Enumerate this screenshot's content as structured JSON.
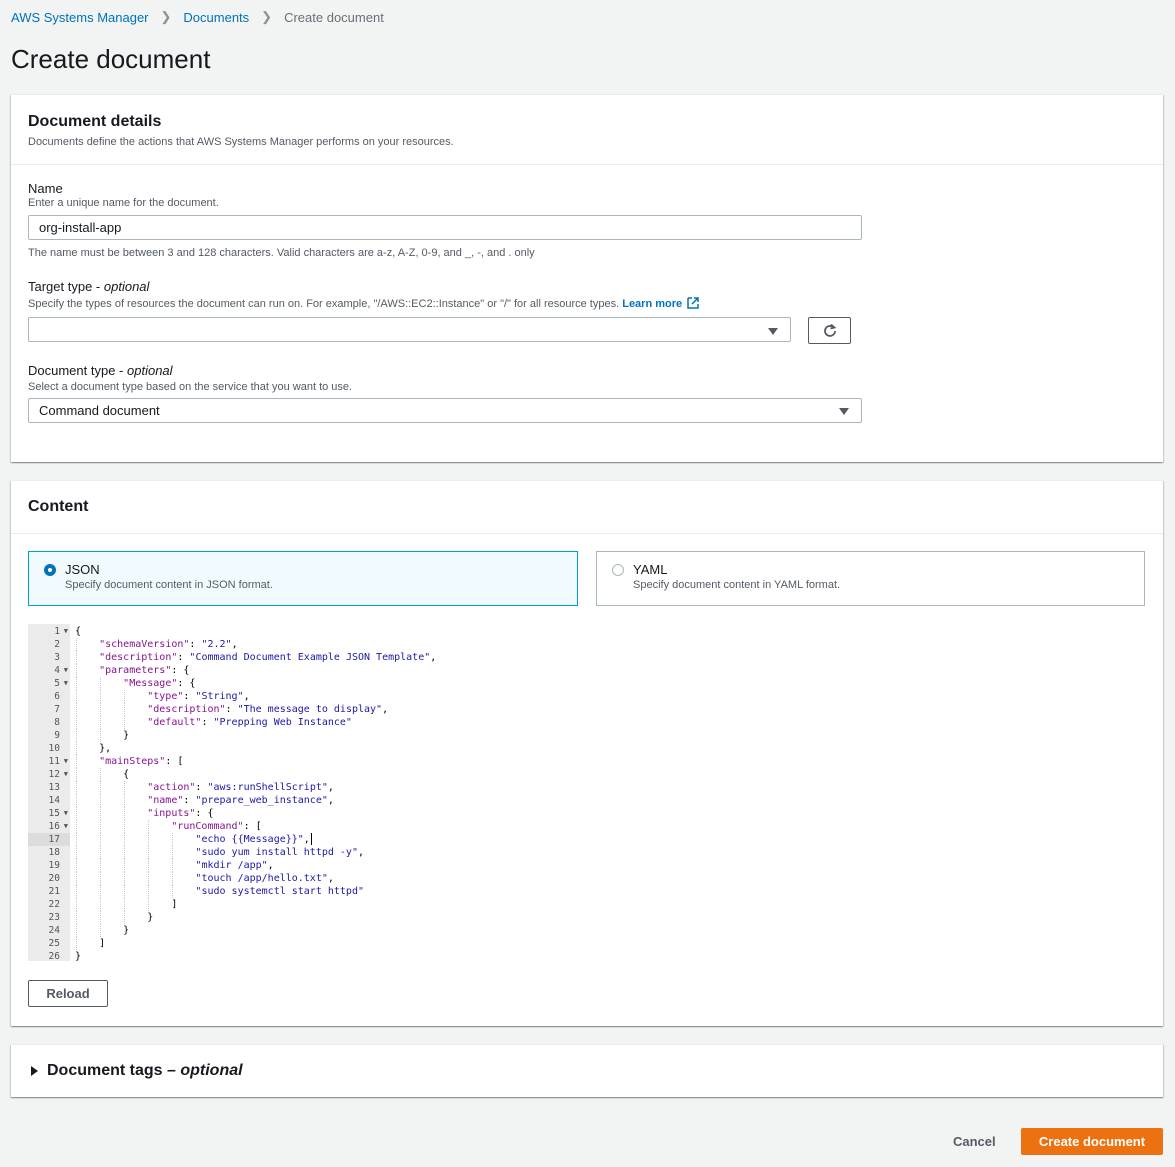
{
  "breadcrumb": {
    "items": [
      "AWS Systems Manager",
      "Documents"
    ],
    "current": "Create document"
  },
  "page_title": "Create document",
  "details": {
    "title": "Document details",
    "description": "Documents define the actions that AWS Systems Manager performs on your resources.",
    "name": {
      "label": "Name",
      "hint": "Enter a unique name for the document.",
      "value": "org-install-app",
      "constraint": "The name must be between 3 and 128 characters. Valid characters are a-z, A-Z, 0-9, and _, -, and . only"
    },
    "target_type": {
      "label": "Target type - ",
      "label_optional": "optional",
      "hint": "Specify the types of resources the document can run on. For example, \"/AWS::EC2::Instance\" or \"/\" for all resource types.",
      "learn_more": "Learn more",
      "value": ""
    },
    "document_type": {
      "label": "Document type - ",
      "label_optional": "optional",
      "hint": "Select a document type based on the service that you want to use.",
      "value": "Command document"
    }
  },
  "content": {
    "title": "Content",
    "formats": [
      {
        "title": "JSON",
        "desc": "Specify document content in JSON format.",
        "selected": true
      },
      {
        "title": "YAML",
        "desc": "Specify document content in YAML format.",
        "selected": false
      }
    ],
    "code_lines": [
      "{",
      "    \"schemaVersion\": \"2.2\",",
      "    \"description\": \"Command Document Example JSON Template\",",
      "    \"parameters\": {",
      "        \"Message\": {",
      "            \"type\": \"String\",",
      "            \"description\": \"The message to display\",",
      "            \"default\": \"Prepping Web Instance\"",
      "        }",
      "    },",
      "    \"mainSteps\": [",
      "        {",
      "            \"action\": \"aws:runShellScript\",",
      "            \"name\": \"prepare_web_instance\",",
      "            \"inputs\": {",
      "                \"runCommand\": [",
      "                    \"echo {{Message}}\",",
      "                    \"sudo yum install httpd -y\",",
      "                    \"mkdir /app\",",
      "                    \"touch /app/hello.txt\",",
      "                    \"sudo systemctl start httpd\"",
      "                ]",
      "            }",
      "        }",
      "    ]",
      "}"
    ],
    "fold_lines": [
      1,
      4,
      5,
      11,
      12,
      15,
      16
    ],
    "active_line": 17,
    "reload_label": "Reload"
  },
  "tags": {
    "title": "Document tags – ",
    "title_optional": "optional"
  },
  "footer": {
    "cancel_label": "Cancel",
    "create_label": "Create document"
  },
  "colors": {
    "primary": "#ec7211",
    "link": "#0073bb",
    "selected_border": "#00a1c9"
  }
}
